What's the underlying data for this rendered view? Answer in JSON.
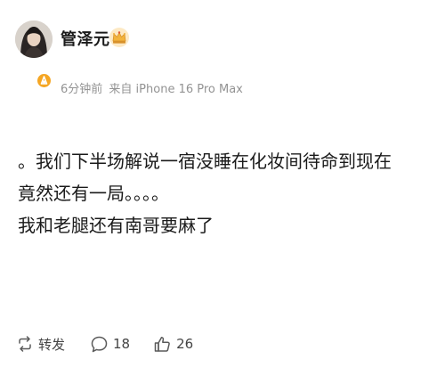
{
  "author": {
    "name": "管泽元",
    "avatar_icon": "user-avatar",
    "verified_icon": "verified-badge-icon",
    "crown_icon": "crown-membership-icon"
  },
  "meta": {
    "time": "6分钟前",
    "source": "来自 iPhone 16 Pro Max"
  },
  "content": {
    "lines": [
      "。我们下半场解说一宿没睡在化妆间待命到现在",
      "竟然还有一局。。。。",
      "我和老腿还有南哥要麻了"
    ]
  },
  "actions": {
    "repost_label": "转发",
    "comment_count": "18",
    "like_count": "26"
  },
  "colors": {
    "text": "#1a1a1a",
    "meta": "#939393",
    "badge": "#f5a623"
  }
}
